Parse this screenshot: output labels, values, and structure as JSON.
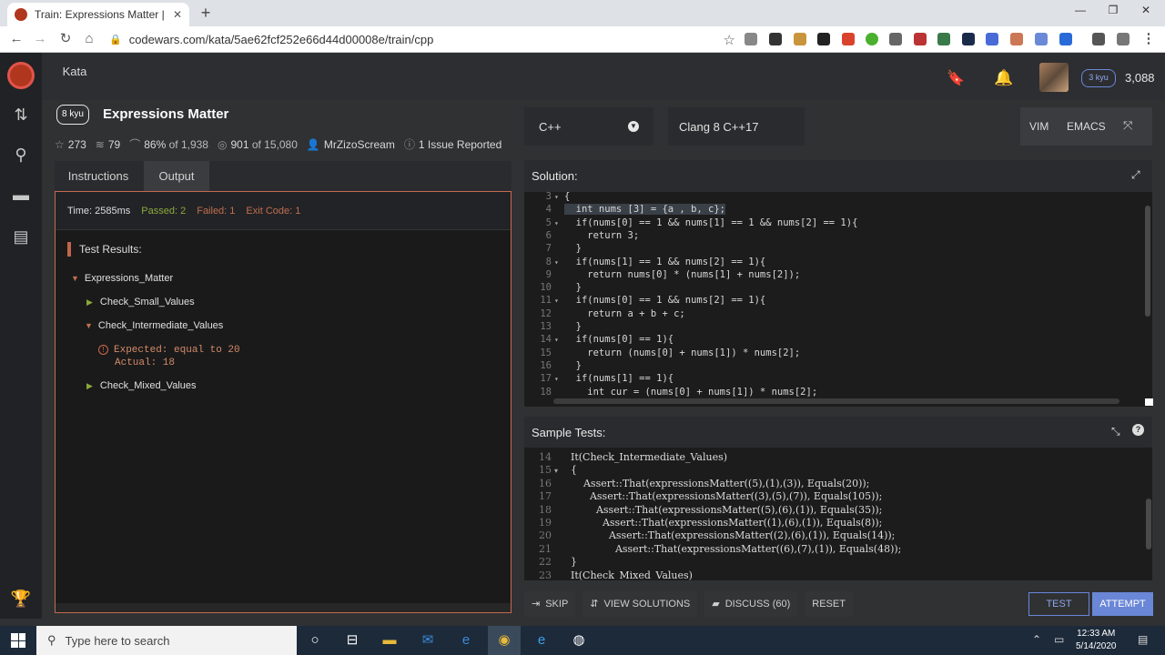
{
  "browser": {
    "tab_title": "Train: Expressions Matter | Codew",
    "url": "codewars.com/kata/5ae62fcf252e66d44d00008e/train/cpp"
  },
  "header": {
    "nav_tab": "Kata",
    "rank": "3 kyu",
    "honor": "3,088"
  },
  "kata": {
    "kyu": "8 kyu",
    "title": "Expressions Matter",
    "stars": "273",
    "collections": "79",
    "satisfaction": "86%",
    "satisfaction_of": "of 1,938",
    "completed": "901",
    "completed_of": "of 15,080",
    "author": "MrZizoScream",
    "issues": "1 Issue Reported"
  },
  "left_tabs": {
    "instructions": "Instructions",
    "output": "Output"
  },
  "output": {
    "time": "Time: 2585ms",
    "passed": "Passed: 2",
    "failed": "Failed: 1",
    "exit_code": "Exit Code: 1",
    "results_label": "Test Results:",
    "suite": "Expressions_Matter",
    "tests": [
      "Check_Small_Values",
      "Check_Intermediate_Values",
      "Check_Mixed_Values"
    ],
    "fail_expected": "Expected: equal to 20",
    "fail_actual": "Actual: 18"
  },
  "editor": {
    "language": "C++",
    "version": "Clang 8 C++17",
    "mode_vim": "VIM",
    "mode_emacs": "EMACS",
    "solution_label": "Solution:",
    "solution_lines": [
      {
        "n": "3",
        "f": "▾",
        "t": "{"
      },
      {
        "n": "4",
        "f": "",
        "t": "  int nums [3] = {a , b, c};"
      },
      {
        "n": "5",
        "f": "▾",
        "t": "  if(nums[0] == 1 && nums[1] == 1 && nums[2] == 1){"
      },
      {
        "n": "6",
        "f": "",
        "t": "    return 3;"
      },
      {
        "n": "7",
        "f": "",
        "t": "  }"
      },
      {
        "n": "8",
        "f": "▾",
        "t": "  if(nums[1] == 1 && nums[2] == 1){"
      },
      {
        "n": "9",
        "f": "",
        "t": "    return nums[0] * (nums[1] + nums[2]);"
      },
      {
        "n": "10",
        "f": "",
        "t": "  }"
      },
      {
        "n": "11",
        "f": "▾",
        "t": "  if(nums[0] == 1 && nums[2] == 1){"
      },
      {
        "n": "12",
        "f": "",
        "t": "    return a + b + c;"
      },
      {
        "n": "13",
        "f": "",
        "t": "  }"
      },
      {
        "n": "14",
        "f": "▾",
        "t": "  if(nums[0] == 1){"
      },
      {
        "n": "15",
        "f": "",
        "t": "    return (nums[0] + nums[1]) * nums[2];"
      },
      {
        "n": "16",
        "f": "",
        "t": "  }"
      },
      {
        "n": "17",
        "f": "▾",
        "t": "  if(nums[1] == 1){"
      },
      {
        "n": "18",
        "f": "",
        "t": "    int cur = (nums[0] + nums[1]) * nums[2];"
      }
    ],
    "tests_label": "Sample Tests:",
    "test_lines": [
      {
        "n": "14",
        "f": "",
        "t": "  It(Check_Intermediate_Values)"
      },
      {
        "n": "15",
        "f": "▾",
        "t": "  {"
      },
      {
        "n": "16",
        "f": "",
        "t": "      Assert::That(expressionsMatter((5),(1),(3)), Equals(20));"
      },
      {
        "n": "17",
        "f": "",
        "t": "        Assert::That(expressionsMatter((3),(5),(7)), Equals(105));"
      },
      {
        "n": "18",
        "f": "",
        "t": "          Assert::That(expressionsMatter((5),(6),(1)), Equals(35));"
      },
      {
        "n": "19",
        "f": "",
        "t": "            Assert::That(expressionsMatter((1),(6),(1)), Equals(8));"
      },
      {
        "n": "20",
        "f": "",
        "t": "              Assert::That(expressionsMatter((2),(6),(1)), Equals(14));"
      },
      {
        "n": "21",
        "f": "",
        "t": "                Assert::That(expressionsMatter((6),(7),(1)), Equals(48));"
      },
      {
        "n": "22",
        "f": "",
        "t": "  }"
      },
      {
        "n": "23",
        "f": "",
        "t": "  It(Check_Mixed_Values)"
      }
    ]
  },
  "actions": {
    "skip": "SKIP",
    "view_solutions": "VIEW SOLUTIONS",
    "discuss": "DISCUSS (60)",
    "reset": "RESET",
    "test": "TEST",
    "attempt": "ATTEMPT"
  },
  "taskbar": {
    "search_placeholder": "Type here to search",
    "time": "12:33 AM",
    "date": "5/14/2020"
  }
}
